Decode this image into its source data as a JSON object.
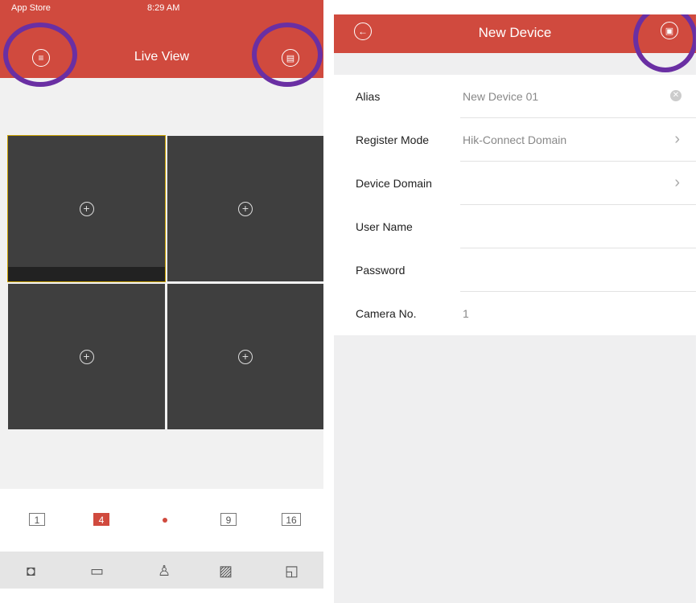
{
  "live_view": {
    "status": {
      "carrier": "App Store",
      "time": "8:29 AM"
    },
    "title": "Live View",
    "layouts": [
      "1",
      "4",
      "9",
      "16"
    ],
    "active_layout": "4",
    "tools": [
      "camera-icon",
      "record-icon",
      "ptz-icon",
      "image-icon",
      "close-all-icon"
    ]
  },
  "new_device": {
    "title": "New Device",
    "fields": [
      {
        "label": "Alias",
        "value": "New Device 01"
      },
      {
        "label": "Register Mode",
        "value": "Hik-Connect Domain"
      },
      {
        "label": "Device Domain",
        "value": ""
      },
      {
        "label": "User Name",
        "value": ""
      },
      {
        "label": "Password",
        "value": ""
      },
      {
        "label": "Camera No.",
        "value": "1"
      }
    ]
  },
  "colors": {
    "header": "#d04a3e",
    "highlight_ring": "#6a2fa3"
  }
}
